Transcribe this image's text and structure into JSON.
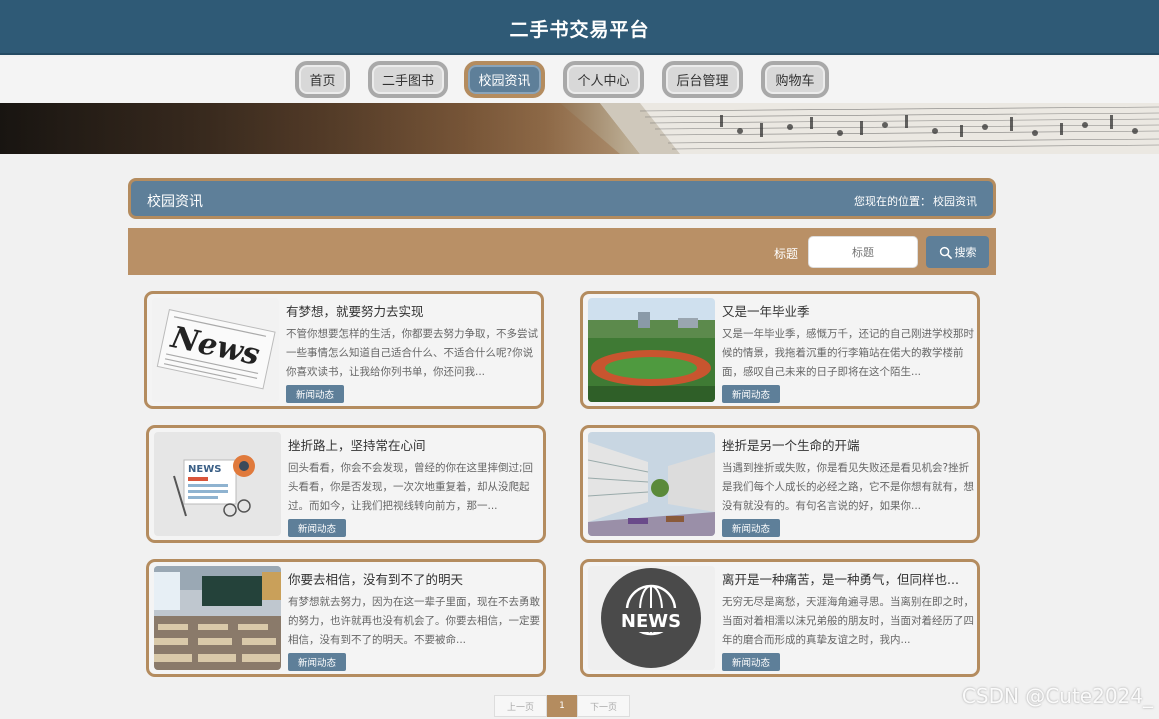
{
  "header": {
    "title": "二手书交易平台",
    "bg_color": "#2f5a76"
  },
  "nav": {
    "items": [
      {
        "label": "首页",
        "active": false
      },
      {
        "label": "二手图书",
        "active": false
      },
      {
        "label": "校园资讯",
        "active": true
      },
      {
        "label": "个人中心",
        "active": false
      },
      {
        "label": "后台管理",
        "active": false
      },
      {
        "label": "购物车",
        "active": false
      }
    ]
  },
  "section": {
    "title": "校园资讯",
    "location_prefix": "您现在的位置：",
    "location_value": "校园资讯",
    "bg_color": "#5e7f99",
    "accent_color": "#b48c5f"
  },
  "search": {
    "label": "标题",
    "placeholder": "标题",
    "button_label": "搜索",
    "button_icon": "search-icon"
  },
  "news": [
    {
      "title": "有梦想，就要努力去实现",
      "summary": "不管你想要怎样的生活，你都要去努力争取，不多尝试一些事情怎么知道自己适合什么、不适合什么呢?你说你喜欢读书，让我给你列书单，你还问我...",
      "tag": "新闻动态",
      "image": "newspaper-news"
    },
    {
      "title": "又是一年毕业季",
      "summary": "又是一年毕业季，感慨万千，还记的自己刚进学校那时候的情景，我拖着沉重的行李箱站在偌大的教学楼前面，感叹自己未来的日子即将在这个陌生...",
      "tag": "新闻动态",
      "image": "campus-running-track"
    },
    {
      "title": "挫折路上，坚持常在心间",
      "summary": "回头看看，你会不会发现，曾经的你在这里摔倒过;回头看看，你是否发现，一次次地重复着，却从没爬起过。而如今，让我们把视线转向前方，那一...",
      "tag": "新闻动态",
      "image": "news-illustration"
    },
    {
      "title": "挫折是另一个生命的开端",
      "summary": "当遇到挫折或失败，你是看见失败还是看见机会?挫折是我们每个人成长的必经之路，它不是你想有就有，想没有就没有的。有句名言说的好，如果你...",
      "tag": "新闻动态",
      "image": "campus-buildings"
    },
    {
      "title": "你要去相信，没有到不了的明天",
      "summary": "有梦想就去努力，因为在这一辈子里面，现在不去勇敢的努力，也许就再也没有机会了。你要去相信，一定要相信，没有到不了的明天。不要被命...",
      "tag": "新闻动态",
      "image": "classroom"
    },
    {
      "title": "离开是一种痛苦，是一种勇气，但同样也...",
      "summary": "无穷无尽是离愁，天涯海角遍寻思。当离别在即之时，当面对着相濡以沫兄弟般的朋友时，当面对着经历了四年的磨合而形成的真挚友谊之时，我内...",
      "tag": "新闻动态",
      "image": "news-globe-icon"
    }
  ],
  "pagination": {
    "prev": "上一页",
    "current": "1",
    "next": "下一页"
  },
  "watermark": "CSDN @Cute2024_"
}
